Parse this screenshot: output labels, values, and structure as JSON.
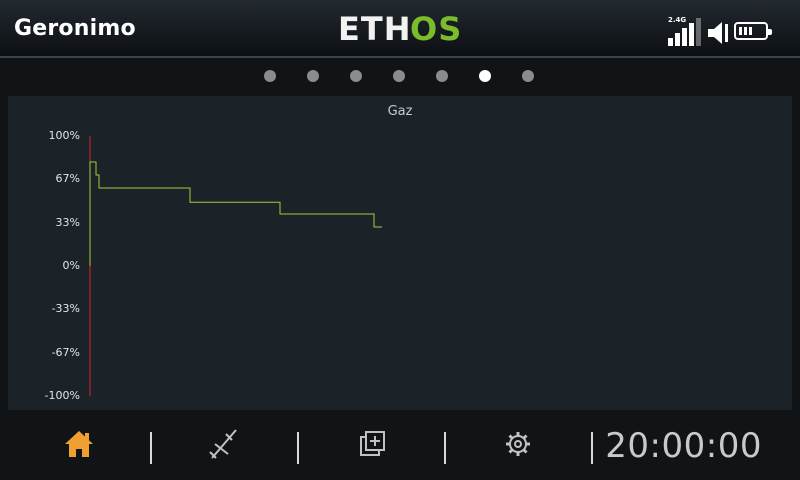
{
  "header": {
    "model_name": "Geronimo",
    "logo": {
      "part1": "ETH",
      "part2": "OS"
    },
    "radio_band": "2.4G",
    "battery_level": 0.6
  },
  "pager": {
    "count": 7,
    "active_index": 5
  },
  "chart_data": {
    "type": "line",
    "title": "Gaz",
    "y_tick_labels": [
      "100%",
      "67%",
      "33%",
      "0%",
      "-33%",
      "-67%",
      "-100%"
    ],
    "ylim": [
      -100,
      100
    ],
    "series": [
      {
        "color": "#a6c93a",
        "points": [
          [
            0,
            0
          ],
          [
            0,
            80
          ],
          [
            6,
            80
          ],
          [
            6,
            70
          ],
          [
            9,
            70
          ],
          [
            9,
            60
          ],
          [
            100,
            60
          ],
          [
            100,
            49
          ],
          [
            190,
            49
          ],
          [
            190,
            40
          ],
          [
            284,
            40
          ],
          [
            284,
            30
          ],
          [
            292,
            30
          ]
        ]
      }
    ],
    "cursor_color": "#d7262b",
    "xlim": [
      0,
      690
    ]
  },
  "bottom": {
    "home_icon": "home-icon",
    "model_icon": "airplane-icon",
    "displays_icon": "displays-icon",
    "settings_icon": "gear-icon",
    "timer": "20:00:00",
    "accent": "#f0a030"
  }
}
